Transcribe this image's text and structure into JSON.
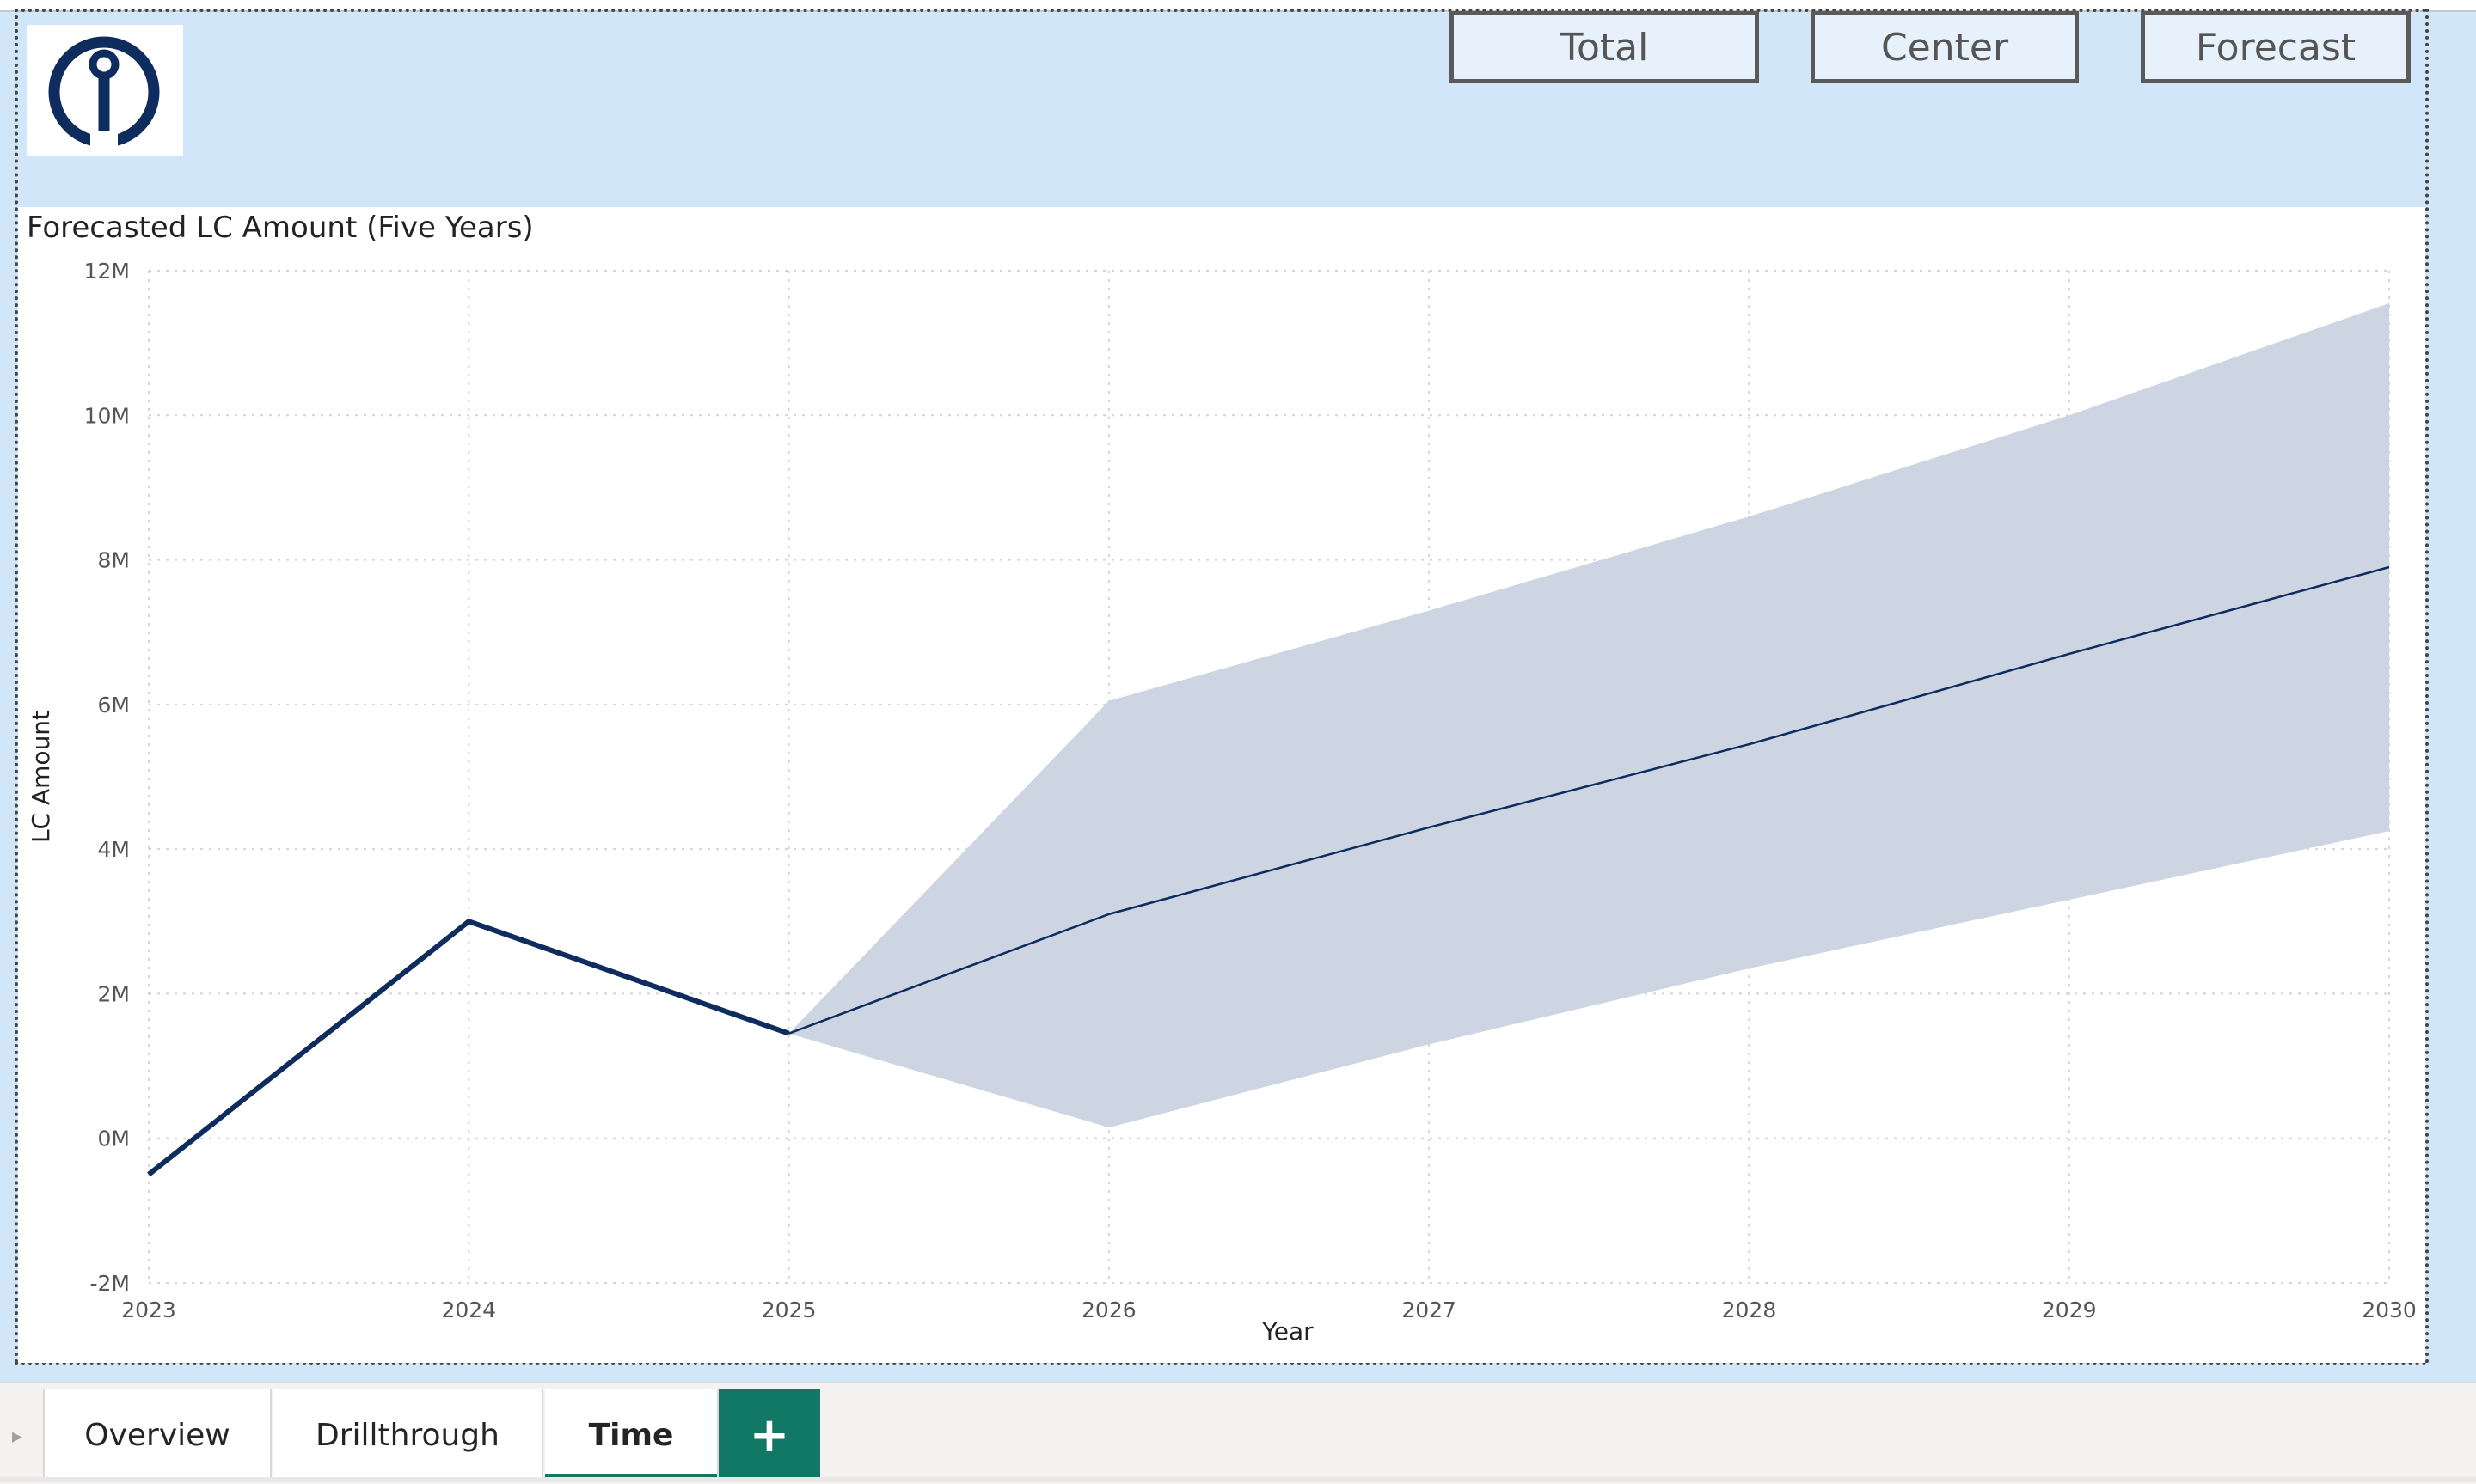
{
  "header": {
    "logo_icon": "anchor-icon",
    "buttons": {
      "total": "Total",
      "center": "Center",
      "forecast": "Forecast"
    }
  },
  "visual": {
    "title": "Forecasted LC Amount (Five Years)"
  },
  "chart_data": {
    "type": "line",
    "title": "Forecasted LC Amount (Five Years)",
    "xlabel": "Year",
    "ylabel": "LC Amount",
    "x_ticks": [
      "2023",
      "2024",
      "2025",
      "2026",
      "2027",
      "2028",
      "2029",
      "2030"
    ],
    "y_ticks": [
      "-2M",
      "0M",
      "2M",
      "4M",
      "6M",
      "8M",
      "10M",
      "12M"
    ],
    "xlim": [
      2023,
      2030
    ],
    "ylim": [
      -2000000,
      12000000
    ],
    "grid": true,
    "actual": {
      "x": [
        2023,
        2024,
        2025
      ],
      "y": [
        -500000,
        3000000,
        1450000
      ]
    },
    "forecast": {
      "x": [
        2025,
        2026,
        2027,
        2028,
        2029,
        2030
      ],
      "y": [
        1450000,
        3100000,
        4300000,
        5450000,
        6700000,
        7900000
      ]
    },
    "confidence_band": {
      "x": [
        2025,
        2026,
        2027,
        2028,
        2029,
        2030
      ],
      "upper": [
        1450000,
        6050000,
        7300000,
        8600000,
        10000000,
        11550000
      ],
      "lower": [
        1450000,
        150000,
        1300000,
        2350000,
        3300000,
        4250000
      ]
    },
    "colors": {
      "line": "#0e2c5e",
      "band": "#cdd5e2",
      "grid": "#d4d4d4"
    }
  },
  "tabs": {
    "scroll_icon": "caret-right-icon",
    "overview": "Overview",
    "drillthrough": "Drillthrough",
    "time": "Time",
    "add": "+"
  }
}
